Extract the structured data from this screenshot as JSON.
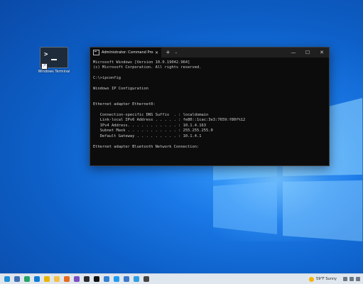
{
  "desktop": {
    "icon_label": "Windows Terminal"
  },
  "terminal": {
    "tab_title": "Administrator: Command Prom",
    "console_lines": [
      "Microsoft Windows [Version 10.0.19042.964]",
      "(c) Microsoft Corporation. All rights reserved.",
      "",
      "C:\\>ipconfig",
      "",
      "Windows IP Configuration",
      "",
      "",
      "Ethernet adapter Ethernet0:",
      "",
      "   Connection-specific DNS Suffix  . : localdomain",
      "   Link-local IPv6 Address . . . . . : fe80::1cac:3e3:7659:f80f%12",
      "   IPv4 Address. . . . . . . . . . . : 10.1.4.163",
      "   Subnet Mask . . . . . . . . . . . : 255.255.255.0",
      "   Default Gateway . . . . . . . . . : 10.1.4.1",
      "",
      "Ethernet adapter Bluetooth Network Connection:"
    ]
  },
  "taskbar": {
    "icons": [
      {
        "name": "edge-icon",
        "color": "#1f8fd6"
      },
      {
        "name": "search-icon",
        "color": "#3d6fb4"
      },
      {
        "name": "edge-icon",
        "color": "#25a36a"
      },
      {
        "name": "edge-icon",
        "color": "#0f7bd4"
      },
      {
        "name": "chrome-icon",
        "color": "#e9b500"
      },
      {
        "name": "folder-icon",
        "color": "#f3c14b"
      },
      {
        "name": "firefox-icon",
        "color": "#e66b1e"
      },
      {
        "name": "app-icon",
        "color": "#7a4fc2"
      },
      {
        "name": "terminal-icon",
        "color": "#2a2a2a"
      },
      {
        "name": "terminal-icon",
        "color": "#111111"
      },
      {
        "name": "photos-icon",
        "color": "#2f7fd2"
      },
      {
        "name": "vscode-icon",
        "color": "#1f9cf0"
      },
      {
        "name": "app-icon",
        "color": "#3a78c9"
      },
      {
        "name": "app-icon",
        "color": "#2e9fe0"
      },
      {
        "name": "camera-icon",
        "color": "#444444"
      }
    ],
    "weather_text": "59°F  Sunny"
  }
}
